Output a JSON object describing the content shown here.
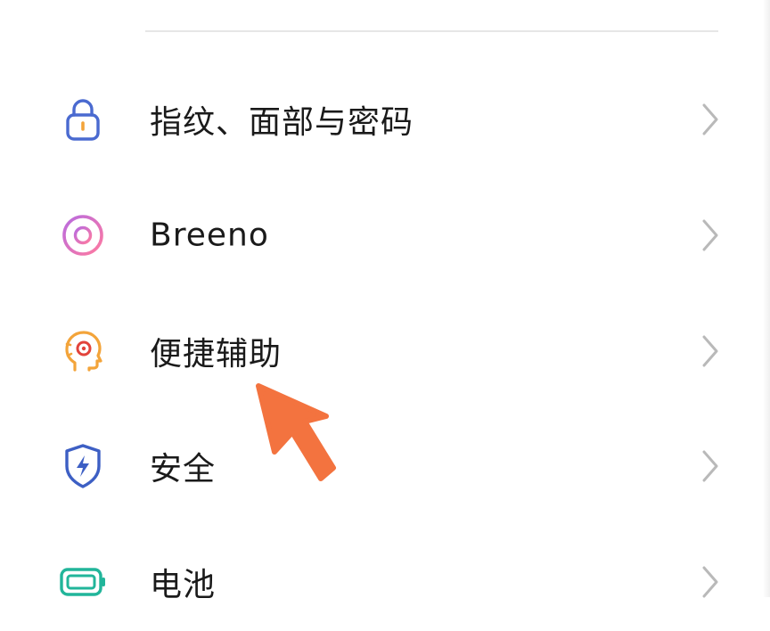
{
  "settings": {
    "items": [
      {
        "label": "指纹、面部与密码",
        "icon": "lock-icon"
      },
      {
        "label": "Breeno",
        "icon": "breeno-ring-icon"
      },
      {
        "label": "便捷辅助",
        "icon": "head-assist-icon"
      },
      {
        "label": "安全",
        "icon": "shield-bolt-icon"
      },
      {
        "label": "电池",
        "icon": "battery-icon"
      }
    ]
  },
  "colors": {
    "lock": "#4a6ad0",
    "breeno_a": "#c86bd6",
    "breeno_b": "#ff7aa0",
    "assist": "#f3a43a",
    "assist_dot": "#e2433b",
    "shield": "#3d5fc4",
    "battery": "#21b59a",
    "chevron": "#b9b9b9",
    "annotation_arrow": "#f3733f"
  }
}
